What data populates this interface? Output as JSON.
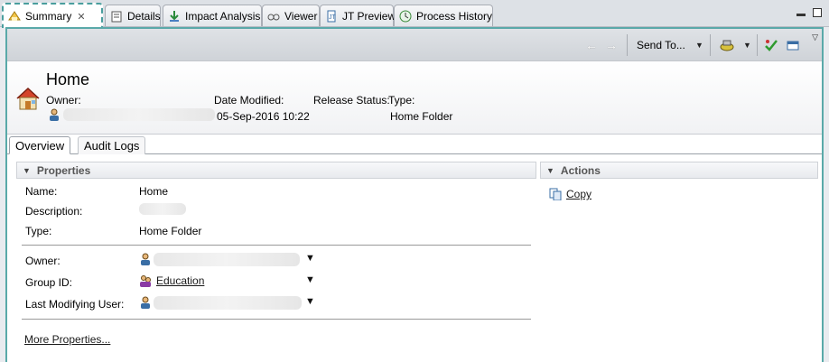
{
  "tabs": [
    {
      "label": "Summary",
      "icon": "summary-icon",
      "active": true
    },
    {
      "label": "Details",
      "icon": "details-icon"
    },
    {
      "label": "Impact Analysis",
      "icon": "impact-analysis-icon"
    },
    {
      "label": "Viewer",
      "icon": "viewer-icon"
    },
    {
      "label": "JT Preview",
      "icon": "jt-preview-icon"
    },
    {
      "label": "Process History",
      "icon": "process-history-icon"
    }
  ],
  "toolbar": {
    "send_to_label": "Send To..."
  },
  "header": {
    "title": "Home",
    "owner_label": "Owner:",
    "date_modified_label": "Date Modified:",
    "date_modified_value": "05-Sep-2016 10:22",
    "release_status_label": "Release Status:",
    "type_label": "Type:",
    "type_value": "Home Folder"
  },
  "subtabs": [
    {
      "label": "Overview",
      "active": true
    },
    {
      "label": "Audit Logs"
    }
  ],
  "properties": {
    "section_title": "Properties",
    "name_label": "Name:",
    "name_value": "Home",
    "description_label": "Description:",
    "type_label": "Type:",
    "type_value": "Home Folder",
    "owner_label": "Owner:",
    "group_id_label": "Group ID:",
    "group_id_value": "Education",
    "last_modifying_user_label": "Last Modifying User:",
    "more_properties_label": "More Properties..."
  },
  "actions": {
    "section_title": "Actions",
    "copy_label": "Copy"
  },
  "colors": {
    "active_tab_border": "#4a9e9e",
    "frame_border": "#5aa9a9"
  }
}
